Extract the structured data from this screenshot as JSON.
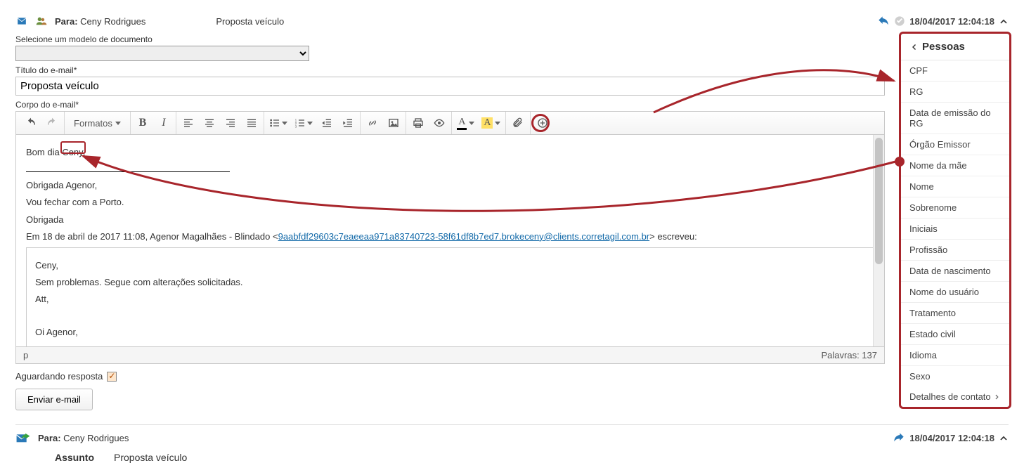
{
  "header": {
    "to_label": "Para:",
    "to_value": "Ceny Rodrigues",
    "subject": "Proposta veículo",
    "timestamp": "18/04/2017 12:04:18"
  },
  "form": {
    "template_label": "Selecione um modelo de documento",
    "title_label": "Título do e-mail*",
    "title_value": "Proposta veículo",
    "body_label": "Corpo do e-mail*"
  },
  "toolbar": {
    "formats_label": "Formatos"
  },
  "email_body": {
    "greeting_prefix": "Bom dia ",
    "greeting_name": "Ceny,",
    "line1": "Obrigada Agenor,",
    "line2": "Vou fechar com a Porto.",
    "line3": "Obrigada",
    "quote_intro_prefix": "Em 18 de abril de 2017 11:08, Agenor Magalhães - Blindado <",
    "quote_intro_link": "9aabfdf29603c7eaeeaa971a83740723-58f61df8b7ed7.brokeceny@clients.corretagil.com.br",
    "quote_intro_suffix": "> escreveu:",
    "q1": "Ceny,",
    "q2": "Sem problemas. Segue com alterações solicitadas.",
    "q3": "Att,",
    "q4": "Oi Agenor,"
  },
  "status": {
    "path": "p",
    "wordcount_label": "Palavras: 137"
  },
  "awaiting_label": "Aguardando resposta",
  "send_label": "Enviar e-mail",
  "thread": {
    "to_label": "Para:",
    "to_value": "Ceny Rodrigues",
    "timestamp": "18/04/2017 12:04:18",
    "subject_label": "Assunto",
    "subject_value": "Proposta veículo"
  },
  "panel": {
    "title": "Pessoas",
    "items": [
      "CPF",
      "RG",
      "Data de emissão do RG",
      "Órgão Emissor",
      "Nome da mãe",
      "Nome",
      "Sobrenome",
      "Iniciais",
      "Profissão",
      "Data de nascimento",
      "Nome do usuário",
      "Tratamento",
      "Estado civil",
      "Idioma",
      "Sexo"
    ],
    "last_label": "Detalhes de contato"
  }
}
